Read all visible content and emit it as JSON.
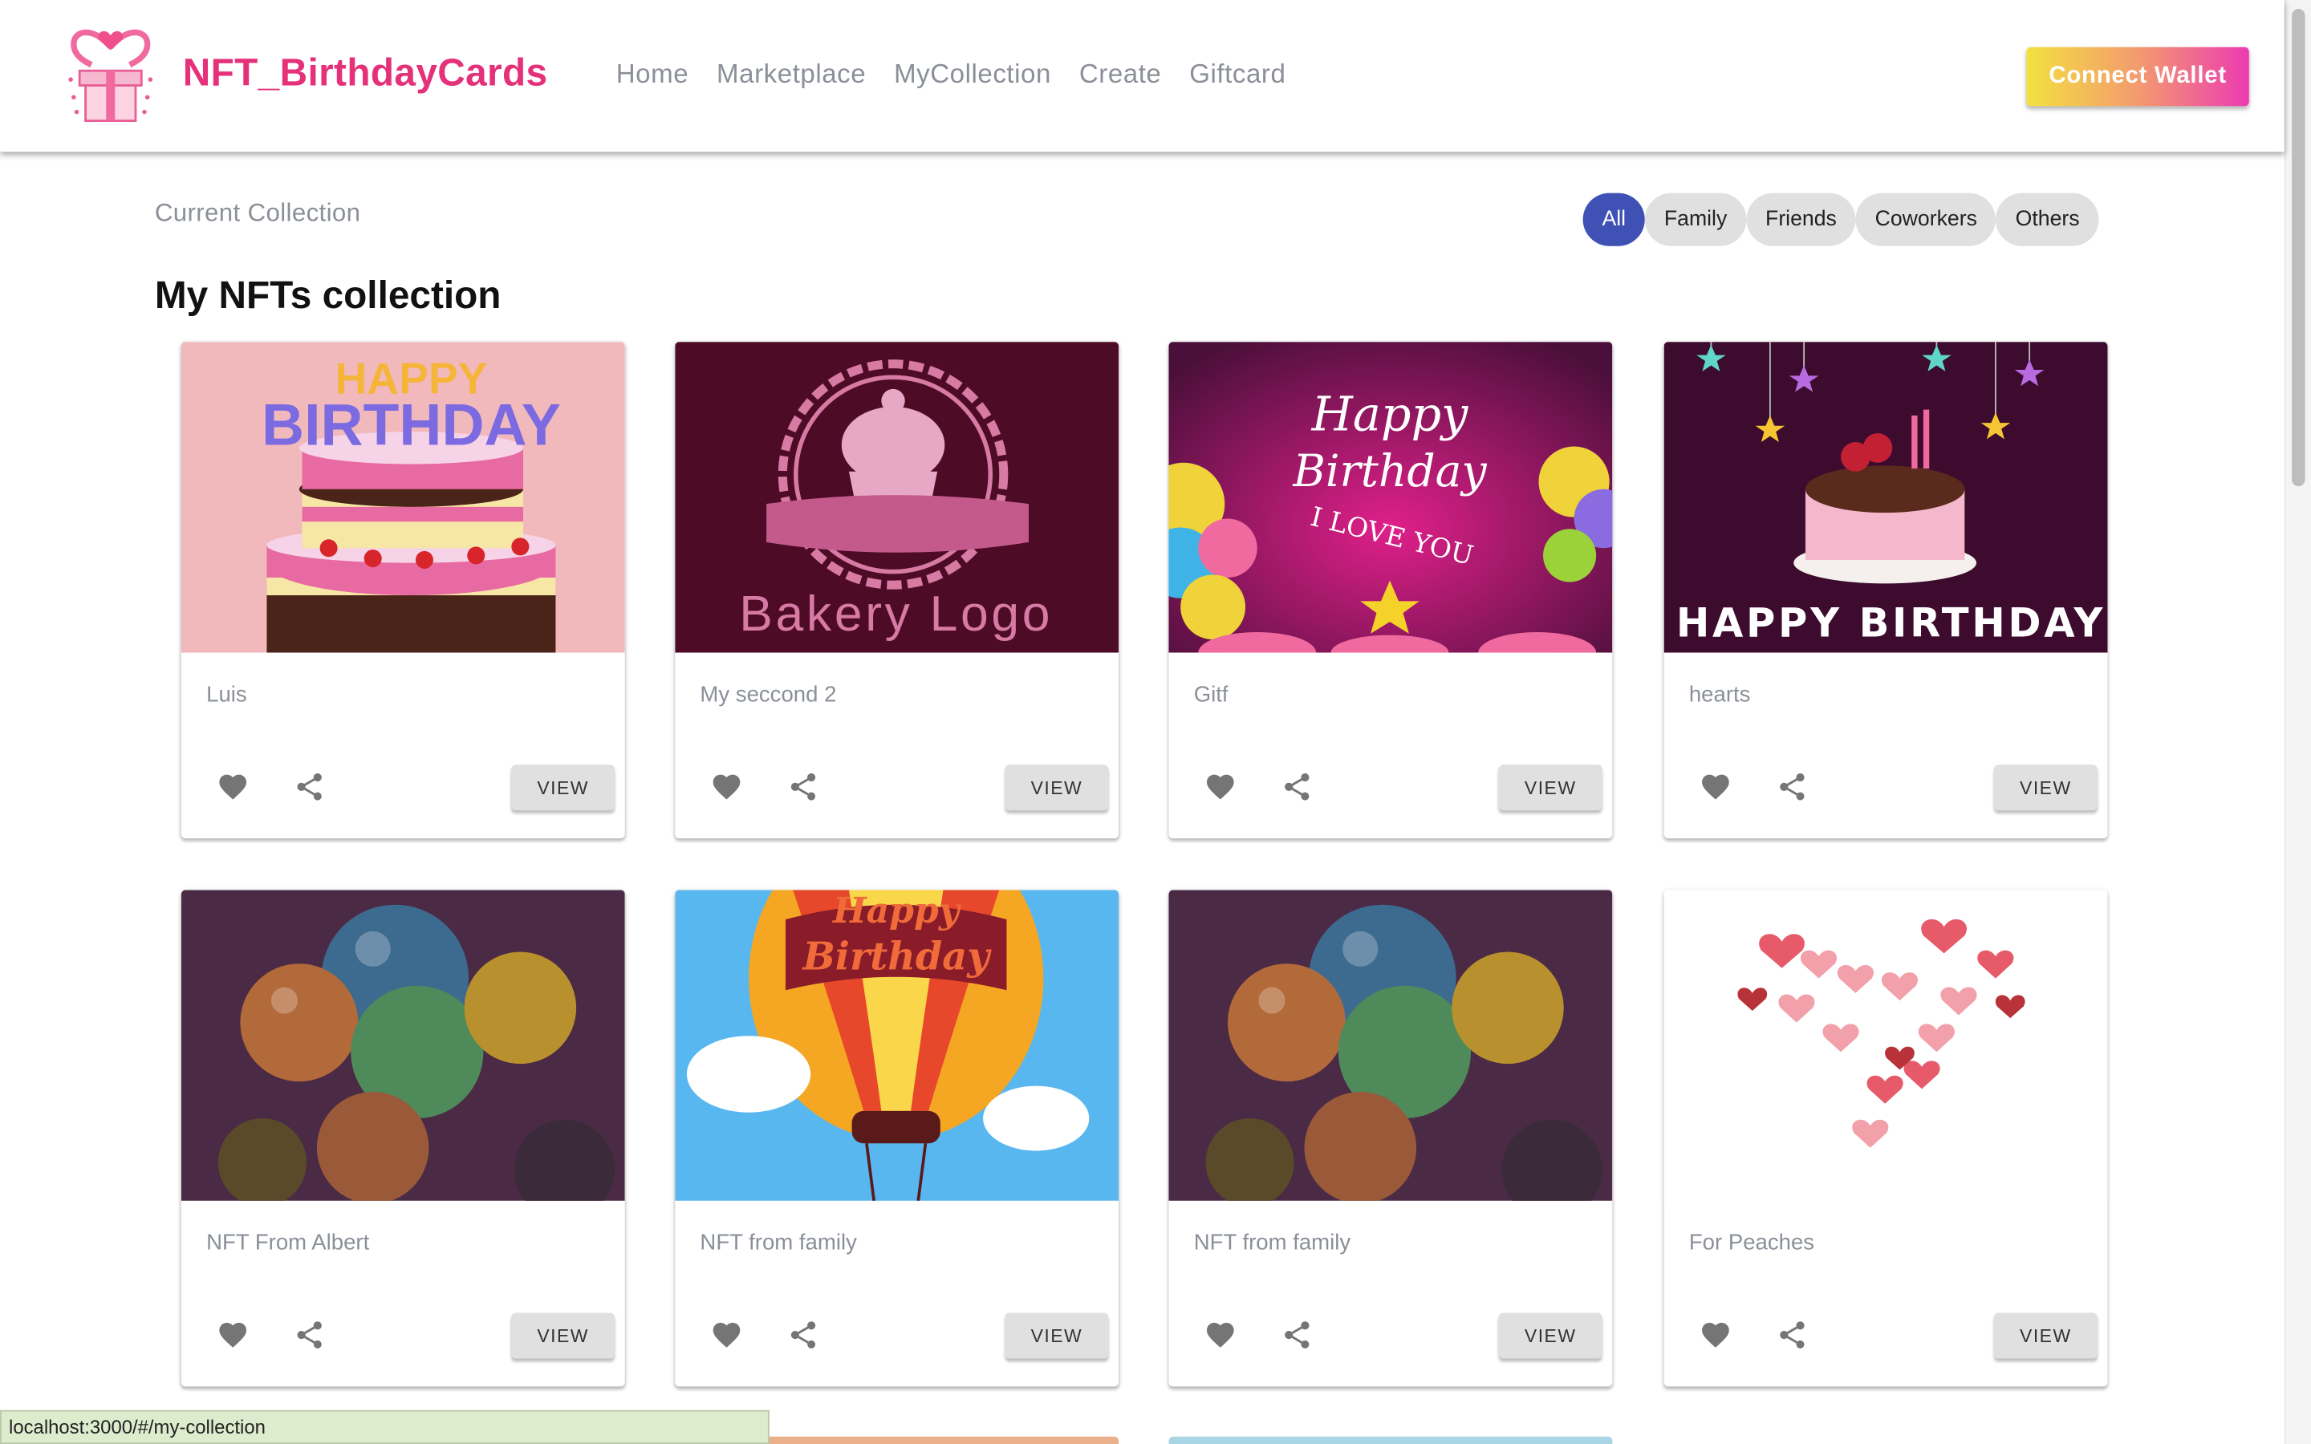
{
  "header": {
    "brand": "NFT_BirthdayCards",
    "nav": [
      "Home",
      "Marketplace",
      "MyCollection",
      "Create",
      "Giftcard"
    ],
    "connect_label": "Connect Wallet"
  },
  "section": {
    "current_label": "Current Collection",
    "title": "My NFTs collection",
    "filters": [
      "All",
      "Family",
      "Friends",
      "Coworkers",
      "Others"
    ],
    "active_filter": "All"
  },
  "cards": [
    {
      "name": "Luis",
      "view_label": "VIEW",
      "image": "birthday-cake-pink"
    },
    {
      "name": "My seccond 2",
      "view_label": "VIEW",
      "image": "bakery-logo",
      "image_text": "Bakery Logo"
    },
    {
      "name": "Gitf",
      "view_label": "VIEW",
      "image": "happy-birthday-i-love-you",
      "image_text": "Happy Birthday I LOVE YOU"
    },
    {
      "name": "hearts",
      "view_label": "VIEW",
      "image": "happy-birthday-cake-stars",
      "image_text": "HAPPY BIRTHDAY"
    },
    {
      "name": "NFT From Albert",
      "view_label": "VIEW",
      "image": "metallic-balloons"
    },
    {
      "name": "NFT from family",
      "view_label": "VIEW",
      "image": "hot-air-balloon",
      "image_text": "Happy Birthday"
    },
    {
      "name": "NFT from family",
      "view_label": "VIEW",
      "image": "metallic-balloons"
    },
    {
      "name": "For Peaches",
      "view_label": "VIEW",
      "image": "heart-of-hearts"
    }
  ],
  "status_bar": "localhost:3000/#/my-collection",
  "colors": {
    "brand": "#e5317a",
    "active_chip": "#3f51b5"
  }
}
